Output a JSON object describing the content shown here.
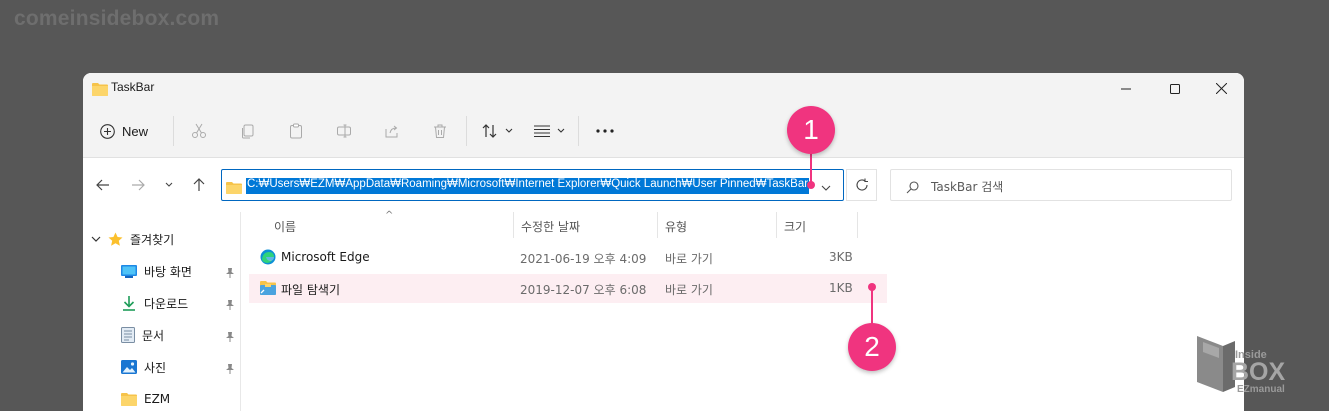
{
  "watermark": "comeinsidebox.com",
  "window": {
    "title": "TaskBar",
    "controls": {
      "minimize": "minimize-icon",
      "maximize": "maximize-icon",
      "close": "close-icon"
    }
  },
  "toolbar": {
    "new_label": "New",
    "icons": [
      "cut-icon",
      "copy-icon",
      "paste-icon",
      "rename-icon",
      "share-icon",
      "delete-icon",
      "sort-icon",
      "view-icon",
      "more-icon"
    ]
  },
  "address": {
    "path": "C:₩Users₩EZM₩AppData₩Roaming₩Microsoft₩Internet Explorer₩Quick Launch₩User Pinned₩TaskBar"
  },
  "search": {
    "placeholder": "TaskBar 검색"
  },
  "sidebar": {
    "items": [
      {
        "label": "즐겨찾기",
        "icon": "star-icon"
      },
      {
        "label": "바탕 화면",
        "icon": "desktop-icon",
        "pinned": true
      },
      {
        "label": "다운로드",
        "icon": "download-icon",
        "pinned": true
      },
      {
        "label": "문서",
        "icon": "document-icon",
        "pinned": true
      },
      {
        "label": "사진",
        "icon": "picture-icon",
        "pinned": true
      },
      {
        "label": "EZM",
        "icon": "folder-icon"
      }
    ]
  },
  "columns": {
    "name": "이름",
    "modified": "수정한 날짜",
    "type": "유형",
    "size": "크기"
  },
  "files": [
    {
      "name": "Microsoft Edge",
      "modified": "2021-06-19 오후 4:09",
      "type": "바로 가기",
      "size": "3KB",
      "icon": "edge-icon"
    },
    {
      "name": "파일 탐색기",
      "modified": "2019-12-07 오후 6:08",
      "type": "바로 가기",
      "size": "1KB",
      "icon": "explorer-icon",
      "selected": true
    }
  ],
  "markers": [
    "1",
    "2"
  ],
  "logo": {
    "line1": "Inside",
    "line2": "BOX",
    "line3": "EZmanual"
  },
  "colors": {
    "accent": "#0078d7",
    "marker": "#f0347f",
    "selection": "#fdeef2",
    "background": "#575757"
  }
}
